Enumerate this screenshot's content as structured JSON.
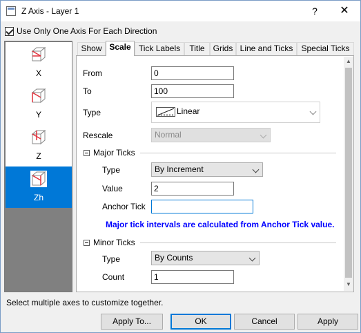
{
  "window": {
    "title": "Z Axis - Layer 1",
    "help_label": "?",
    "close_label": "✕"
  },
  "option": {
    "checkbox_label": "Use Only One Axis For Each Direction",
    "checked": true
  },
  "axes": [
    {
      "label": "X",
      "selected": false
    },
    {
      "label": "Y",
      "selected": false
    },
    {
      "label": "Z",
      "selected": false
    },
    {
      "label": "Zh",
      "selected": true
    }
  ],
  "tabs": [
    {
      "label": "Show",
      "active": false
    },
    {
      "label": "Scale",
      "active": true
    },
    {
      "label": "Tick Labels",
      "active": false
    },
    {
      "label": "Title",
      "active": false
    },
    {
      "label": "Grids",
      "active": false
    },
    {
      "label": "Line and Ticks",
      "active": false
    },
    {
      "label": "Special Ticks",
      "active": false
    }
  ],
  "scale": {
    "from_label": "From",
    "from_value": "0",
    "to_label": "To",
    "to_value": "100",
    "type_label": "Type",
    "type_value": "Linear",
    "rescale_label": "Rescale",
    "rescale_value": "Normal"
  },
  "major_ticks": {
    "header": "Major Ticks",
    "type_label": "Type",
    "type_value": "By Increment",
    "value_label": "Value",
    "value_value": "2",
    "anchor_label": "Anchor Tick",
    "anchor_value": "",
    "hint": "Major tick intervals are calculated from Anchor Tick value."
  },
  "minor_ticks": {
    "header": "Minor Ticks",
    "type_label": "Type",
    "type_value": "By Counts",
    "count_label": "Count",
    "count_value": "1"
  },
  "status_text": "Select multiple axes to customize together.",
  "buttons": {
    "apply_to": "Apply To...",
    "ok": "OK",
    "cancel": "Cancel",
    "apply": "Apply"
  },
  "colors": {
    "selection": "#0078d7",
    "hint": "#0000ff"
  }
}
